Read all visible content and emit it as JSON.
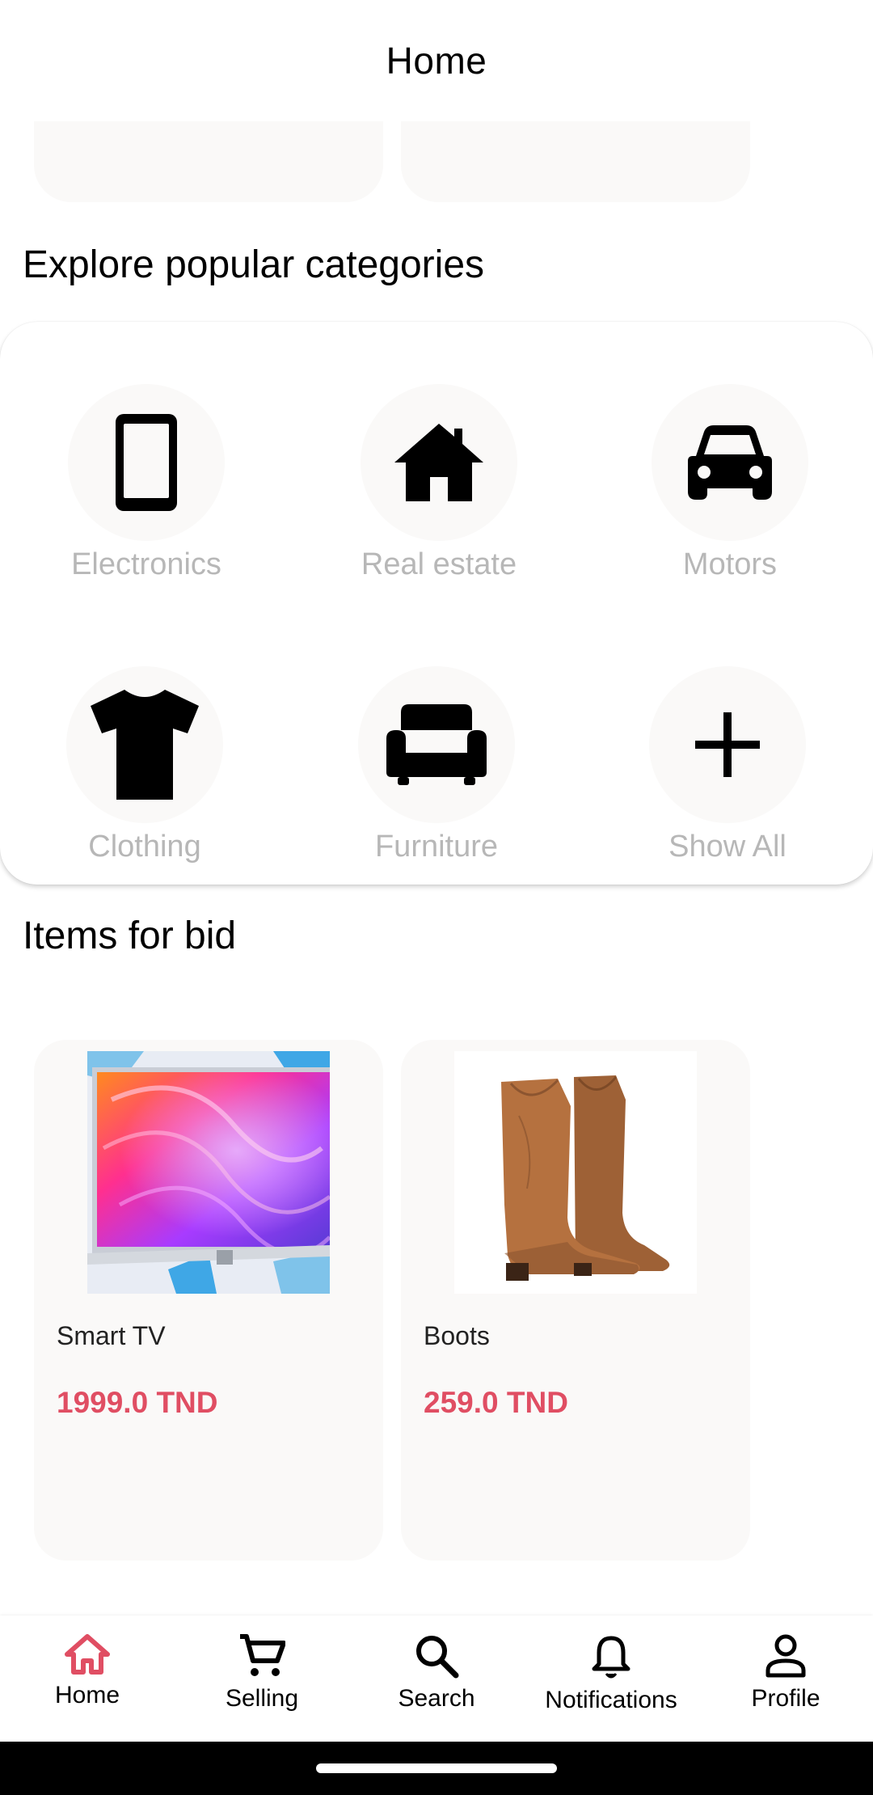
{
  "colors": {
    "accent": "#e04e63",
    "label_gray": "#b7b7b7",
    "card_bg": "#faf9f8"
  },
  "app_bar": {
    "title": "Home"
  },
  "sections": {
    "categories_title": "Explore popular categories",
    "items_title": "Items for bid"
  },
  "categories": [
    {
      "label": "Electronics",
      "icon": "smartphone-icon"
    },
    {
      "label": "Real estate",
      "icon": "house-icon"
    },
    {
      "label": "Motors",
      "icon": "car-icon"
    },
    {
      "label": "Clothing",
      "icon": "tshirt-icon"
    },
    {
      "label": "Furniture",
      "icon": "armchair-icon"
    },
    {
      "label": "Show All",
      "icon": "plus-icon"
    }
  ],
  "items": [
    {
      "name": "Smart TV",
      "price": "1999.0 TND",
      "image": "smart-tv-image"
    },
    {
      "name": "Boots",
      "price": "259.0 TND",
      "image": "boots-image"
    }
  ],
  "nav": [
    {
      "label": "Home",
      "icon": "home-icon",
      "active": true
    },
    {
      "label": "Selling",
      "icon": "cart-icon",
      "active": false
    },
    {
      "label": "Search",
      "icon": "search-icon",
      "active": false
    },
    {
      "label": "Notifications",
      "icon": "bell-icon",
      "active": false
    },
    {
      "label": "Profile",
      "icon": "person-icon",
      "active": false
    }
  ]
}
